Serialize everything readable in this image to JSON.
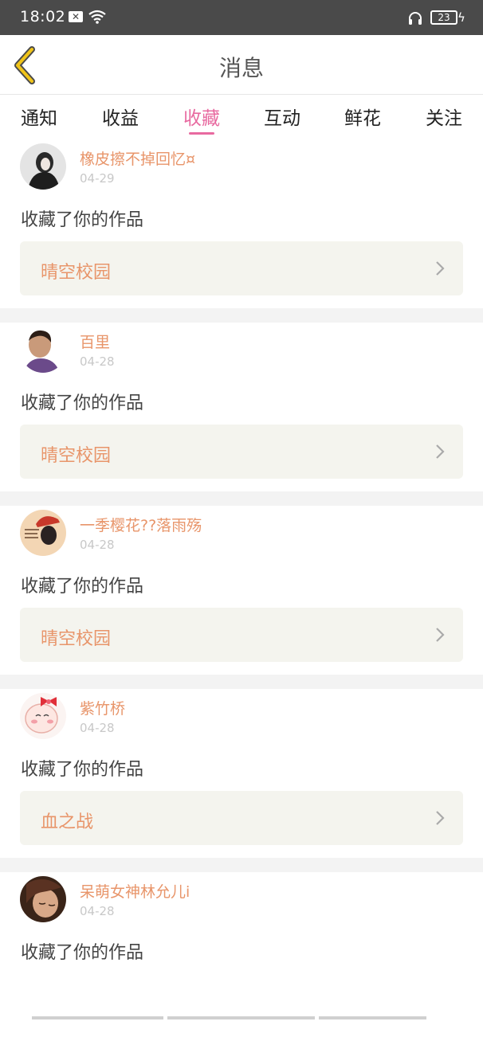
{
  "status_bar": {
    "time": "18:02",
    "notification_icon": "x-notification-icon",
    "battery": "23"
  },
  "header": {
    "title": "消息",
    "back_icon": "chevron-left-icon",
    "accent_color": "#f0c419"
  },
  "tabs": [
    {
      "label": "通知",
      "active": false
    },
    {
      "label": "收益",
      "active": false
    },
    {
      "label": "收藏",
      "active": true
    },
    {
      "label": "互动",
      "active": false
    },
    {
      "label": "鲜花",
      "active": false
    },
    {
      "label": "关注",
      "active": false
    }
  ],
  "colors": {
    "active_tab": "#e86aa0",
    "username": "#e8956a",
    "card_background": "#f4f4ee"
  },
  "items": [
    {
      "username": "橡皮擦不掉回忆¤",
      "date": "04-29",
      "action": "收藏了你的作品",
      "work": "晴空校园"
    },
    {
      "username": "百里",
      "date": "04-28",
      "action": "收藏了你的作品",
      "work": "晴空校园"
    },
    {
      "username": "一季樱花??落雨殇",
      "date": "04-28",
      "action": "收藏了你的作品",
      "work": "晴空校园"
    },
    {
      "username": "紫竹桥",
      "date": "04-28",
      "action": "收藏了你的作品",
      "work": "血之战"
    },
    {
      "username": "呆萌女神林允儿i",
      "date": "04-28",
      "action": "收藏了你的作品",
      "work": ""
    }
  ]
}
